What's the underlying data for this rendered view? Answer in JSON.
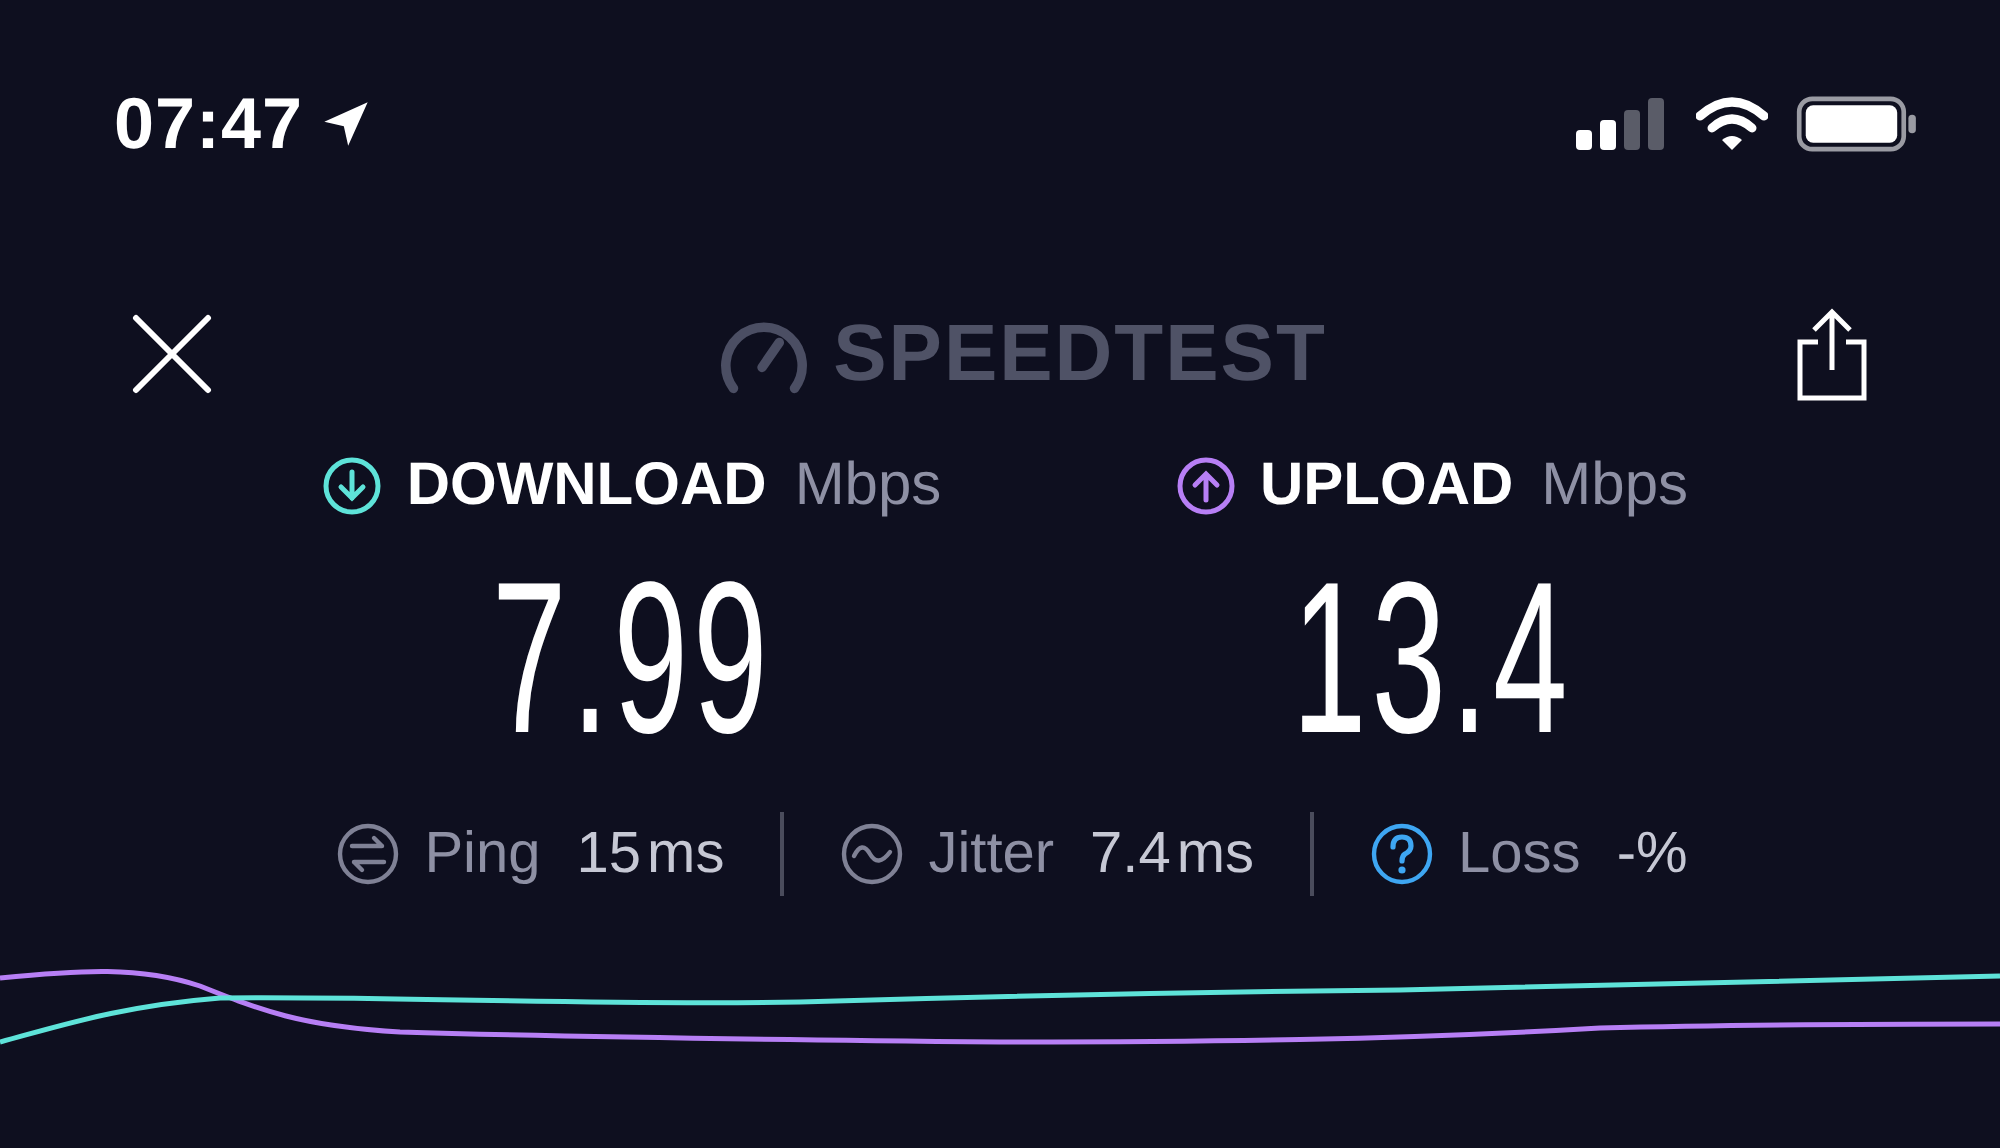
{
  "status_bar": {
    "time": "07:47"
  },
  "header": {
    "logo": "SPEEDTEST"
  },
  "results": [
    {
      "kind": "download",
      "label": "DOWNLOAD",
      "unit": "Mbps",
      "value": "7.99",
      "color": "#5ee3d9"
    },
    {
      "kind": "upload",
      "label": "UPLOAD",
      "unit": "Mbps",
      "value": "13.4",
      "color": "#b77ff5"
    }
  ],
  "metrics": [
    {
      "kind": "ping",
      "label": "Ping",
      "value": "15",
      "unit": "ms"
    },
    {
      "kind": "jitter",
      "label": "Jitter",
      "value": "7.4",
      "unit": "ms"
    },
    {
      "kind": "loss",
      "label": "Loss",
      "value": "-%"
    }
  ]
}
